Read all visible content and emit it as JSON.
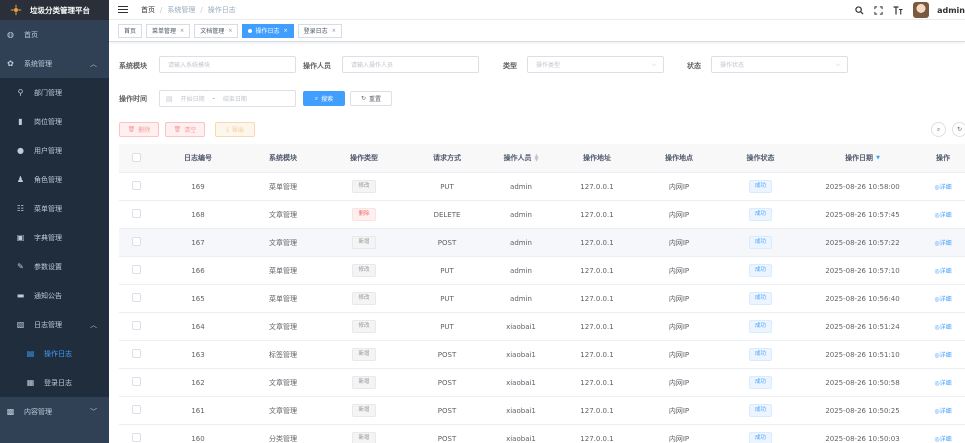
{
  "app": {
    "title": "垃圾分类管理平台"
  },
  "sidebar": {
    "items": [
      {
        "label": "首页",
        "icon": "dashboard-icon",
        "level": "top"
      },
      {
        "label": "系统管理",
        "icon": "gear-icon",
        "level": "top",
        "expanded": true
      },
      {
        "label": "部门管理",
        "icon": "tree-icon",
        "level": "sub"
      },
      {
        "label": "岗位管理",
        "icon": "post-icon",
        "level": "sub"
      },
      {
        "label": "用户管理",
        "icon": "user-icon",
        "level": "sub"
      },
      {
        "label": "角色管理",
        "icon": "peoples-icon",
        "level": "sub"
      },
      {
        "label": "菜单管理",
        "icon": "tree-table-icon",
        "level": "sub"
      },
      {
        "label": "字典管理",
        "icon": "dict-icon",
        "level": "sub"
      },
      {
        "label": "参数设置",
        "icon": "edit-icon",
        "level": "sub"
      },
      {
        "label": "通知公告",
        "icon": "message-icon",
        "level": "sub"
      },
      {
        "label": "日志管理",
        "icon": "log-icon",
        "level": "sub",
        "expanded": true
      },
      {
        "label": "操作日志",
        "icon": "form-icon",
        "level": "l2",
        "active": true
      },
      {
        "label": "登录日志",
        "icon": "logininfor-icon",
        "level": "l2"
      },
      {
        "label": "内容管理",
        "icon": "content-icon",
        "level": "top"
      }
    ]
  },
  "navbar": {
    "breadcrumb": [
      "首页",
      "系统管理",
      "操作日志"
    ],
    "username": "admin"
  },
  "tags": [
    {
      "label": "首页",
      "closable": false,
      "active": false
    },
    {
      "label": "菜单管理",
      "closable": true,
      "active": false
    },
    {
      "label": "文档管理",
      "closable": true,
      "active": false
    },
    {
      "label": "操作日志",
      "closable": true,
      "active": true
    },
    {
      "label": "登录日志",
      "closable": true,
      "active": false
    }
  ],
  "search": {
    "module_label": "系统模块",
    "module_placeholder": "请输入系统模块",
    "operator_label": "操作人员",
    "operator_placeholder": "请输入操作人员",
    "type_label": "类型",
    "type_placeholder": "操作类型",
    "status_label": "状态",
    "status_placeholder": "操作状态",
    "time_label": "操作时间",
    "start_placeholder": "开始日期",
    "end_placeholder": "结束日期",
    "range_separator": "-",
    "search_btn": "搜索",
    "reset_btn": "重置"
  },
  "toolbar": {
    "delete_btn": "删除",
    "clear_btn": "清空",
    "export_btn": "导出"
  },
  "table": {
    "headers": [
      "日志编号",
      "系统模块",
      "操作类型",
      "请求方式",
      "操作人员",
      "操作地址",
      "操作地点",
      "操作状态",
      "操作日期",
      "操作"
    ],
    "rows": [
      {
        "id": "169",
        "module": "菜单管理",
        "type": "修改",
        "type_style": "info",
        "method": "PUT",
        "operator": "admin",
        "ip": "127.0.0.1",
        "location": "内网IP",
        "status": "成功",
        "date": "2025-08-26 10:58:00",
        "action": "详细"
      },
      {
        "id": "168",
        "module": "文章管理",
        "type": "删除",
        "type_style": "danger",
        "method": "DELETE",
        "operator": "admin",
        "ip": "127.0.0.1",
        "location": "内网IP",
        "status": "成功",
        "date": "2025-08-26 10:57:45",
        "action": "详细"
      },
      {
        "id": "167",
        "module": "文章管理",
        "type": "新增",
        "type_style": "info",
        "method": "POST",
        "operator": "admin",
        "ip": "127.0.0.1",
        "location": "内网IP",
        "status": "成功",
        "date": "2025-08-26 10:57:22",
        "action": "详细"
      },
      {
        "id": "166",
        "module": "菜单管理",
        "type": "修改",
        "type_style": "info",
        "method": "PUT",
        "operator": "admin",
        "ip": "127.0.0.1",
        "location": "内网IP",
        "status": "成功",
        "date": "2025-08-26 10:57:10",
        "action": "详细"
      },
      {
        "id": "165",
        "module": "菜单管理",
        "type": "修改",
        "type_style": "info",
        "method": "PUT",
        "operator": "admin",
        "ip": "127.0.0.1",
        "location": "内网IP",
        "status": "成功",
        "date": "2025-08-26 10:56:40",
        "action": "详细"
      },
      {
        "id": "164",
        "module": "文章管理",
        "type": "修改",
        "type_style": "info",
        "method": "PUT",
        "operator": "xiaobai1",
        "ip": "127.0.0.1",
        "location": "内网IP",
        "status": "成功",
        "date": "2025-08-26 10:51:24",
        "action": "详细"
      },
      {
        "id": "163",
        "module": "标签管理",
        "type": "新增",
        "type_style": "info",
        "method": "POST",
        "operator": "xiaobai1",
        "ip": "127.0.0.1",
        "location": "内网IP",
        "status": "成功",
        "date": "2025-08-26 10:51:10",
        "action": "详细"
      },
      {
        "id": "162",
        "module": "文章管理",
        "type": "新增",
        "type_style": "info",
        "method": "POST",
        "operator": "xiaobai1",
        "ip": "127.0.0.1",
        "location": "内网IP",
        "status": "成功",
        "date": "2025-08-26 10:50:58",
        "action": "详细"
      },
      {
        "id": "161",
        "module": "文章管理",
        "type": "新增",
        "type_style": "info",
        "method": "POST",
        "operator": "xiaobai1",
        "ip": "127.0.0.1",
        "location": "内网IP",
        "status": "成功",
        "date": "2025-08-26 10:50:25",
        "action": "详细"
      },
      {
        "id": "160",
        "module": "分类管理",
        "type": "新增",
        "type_style": "info",
        "method": "POST",
        "operator": "xiaobai1",
        "ip": "127.0.0.1",
        "location": "内网IP",
        "status": "成功",
        "date": "2025-08-26 10:50:03",
        "action": "详细"
      }
    ]
  },
  "colors": {
    "sidebar_bg": "#304156",
    "primary": "#409eff",
    "danger": "#f56c6c"
  }
}
